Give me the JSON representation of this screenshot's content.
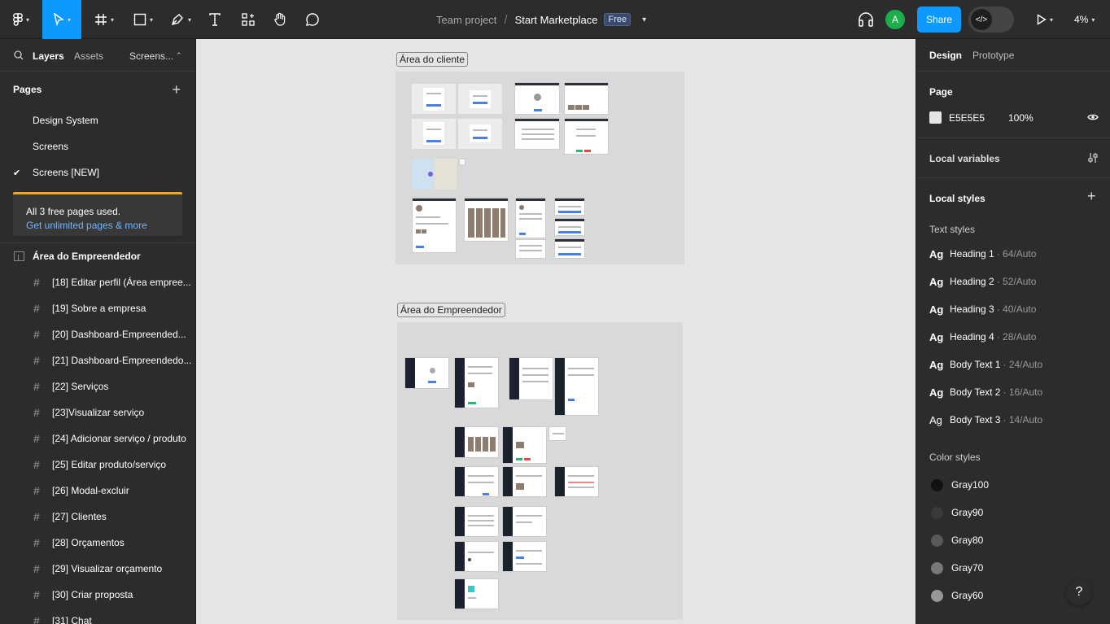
{
  "toolbar": {
    "breadcrumb_team": "Team project",
    "breadcrumb_sep": "/",
    "file_name": "Start Marketplace",
    "plan_badge": "Free",
    "share_label": "Share",
    "avatar_initial": "A",
    "zoom_level": "4%",
    "accent_color": "#0d99ff"
  },
  "left_panel": {
    "tabs": {
      "layers": "Layers",
      "assets": "Assets",
      "page_switch": "Screens..."
    },
    "pages_title": "Pages",
    "pages": [
      {
        "label": "Design System"
      },
      {
        "label": "Screens"
      },
      {
        "label": "Screens [NEW]",
        "selected": true
      }
    ],
    "upgrade": {
      "text": "All 3 free pages used.",
      "link": "Get unlimited pages & more"
    },
    "section": "Área do Empreendedor",
    "layers": [
      "[18] Editar perfil (Área empree...",
      "[19] Sobre a empresa",
      "[20] Dashboard-Empreended...",
      "[21] Dashboard-Empreendedo...",
      "[22] Serviços",
      "[23]Visualizar serviço",
      "[24] Adicionar serviço / produto",
      "[25] Editar produto/serviço",
      "[26] Modal-excluir",
      "[27] Clientes",
      "[28] Orçamentos",
      "[29] Visualizar orçamento",
      "[30] Criar proposta",
      "[31] Chat"
    ]
  },
  "canvas": {
    "sections": [
      {
        "label": "Área do cliente"
      },
      {
        "label": "Área do Empreendedor"
      }
    ]
  },
  "right_panel": {
    "tabs": {
      "design": "Design",
      "prototype": "Prototype"
    },
    "page": {
      "title": "Page",
      "color_hex": "E5E5E5",
      "opacity": "100%"
    },
    "local_variables": "Local variables",
    "local_styles": "Local styles",
    "text_styles_title": "Text styles",
    "text_styles": [
      {
        "ag": "Ag",
        "name": "Heading 1",
        "meta": "· 64/Auto"
      },
      {
        "ag": "Ag",
        "name": "Heading 2",
        "meta": "· 52/Auto"
      },
      {
        "ag": "Ag",
        "name": "Heading 3",
        "meta": "· 40/Auto"
      },
      {
        "ag": "Ag",
        "name": "Heading 4",
        "meta": "· 28/Auto"
      },
      {
        "ag": "Ag",
        "name": "Body Text 1",
        "meta": "· 24/Auto"
      },
      {
        "ag": "Ag",
        "name": "Body Text 2",
        "meta": "· 16/Auto"
      },
      {
        "ag": "Ag",
        "name": "Body Text 3",
        "meta": "· 14/Auto"
      }
    ],
    "color_styles_title": "Color styles",
    "color_styles": [
      {
        "name": "Gray100",
        "color": "#111111"
      },
      {
        "name": "Gray90",
        "color": "#3a3a3a"
      },
      {
        "name": "Gray80",
        "color": "#595959"
      },
      {
        "name": "Gray70",
        "color": "#787878"
      },
      {
        "name": "Gray60",
        "color": "#979797"
      }
    ]
  },
  "help_label": "?"
}
